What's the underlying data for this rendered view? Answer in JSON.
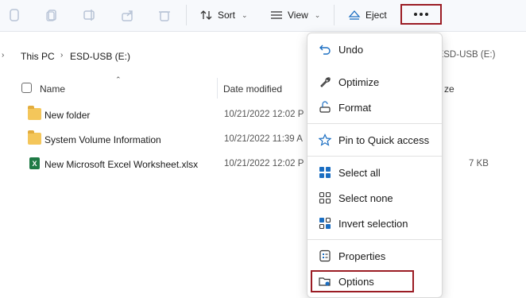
{
  "toolbar": {
    "sort_label": "Sort",
    "view_label": "View",
    "eject_label": "Eject"
  },
  "address": {
    "crumbs": [
      "This PC",
      "ESD-USB (E:)"
    ],
    "search_hint": "h ESD-USB (E:)"
  },
  "columns": {
    "name": "Name",
    "date_modified": "Date modified",
    "size_partial": "ze"
  },
  "files": [
    {
      "name": "New folder",
      "date": "10/21/2022 12:02 P",
      "type": "folder",
      "size": ""
    },
    {
      "name": "System Volume Information",
      "date": "10/21/2022 11:39 A",
      "type": "folder",
      "size": ""
    },
    {
      "name": "New Microsoft Excel Worksheet.xlsx",
      "date": "10/21/2022 12:02 P",
      "type": "excel",
      "size": "7 KB"
    }
  ],
  "menu": {
    "items": [
      {
        "label": "Undo",
        "icon": "undo-icon"
      },
      {
        "label": "Optimize",
        "icon": "wrench-icon"
      },
      {
        "label": "Format",
        "icon": "format-icon"
      },
      {
        "label": "Pin to Quick access",
        "icon": "star-icon"
      },
      {
        "label": "Select all",
        "icon": "select-all-icon"
      },
      {
        "label": "Select none",
        "icon": "select-none-icon"
      },
      {
        "label": "Invert selection",
        "icon": "invert-selection-icon"
      },
      {
        "label": "Properties",
        "icon": "properties-icon"
      },
      {
        "label": "Options",
        "icon": "options-icon"
      }
    ]
  },
  "colors": {
    "highlight": "#9b1c24",
    "accent": "#1b6ec2"
  }
}
